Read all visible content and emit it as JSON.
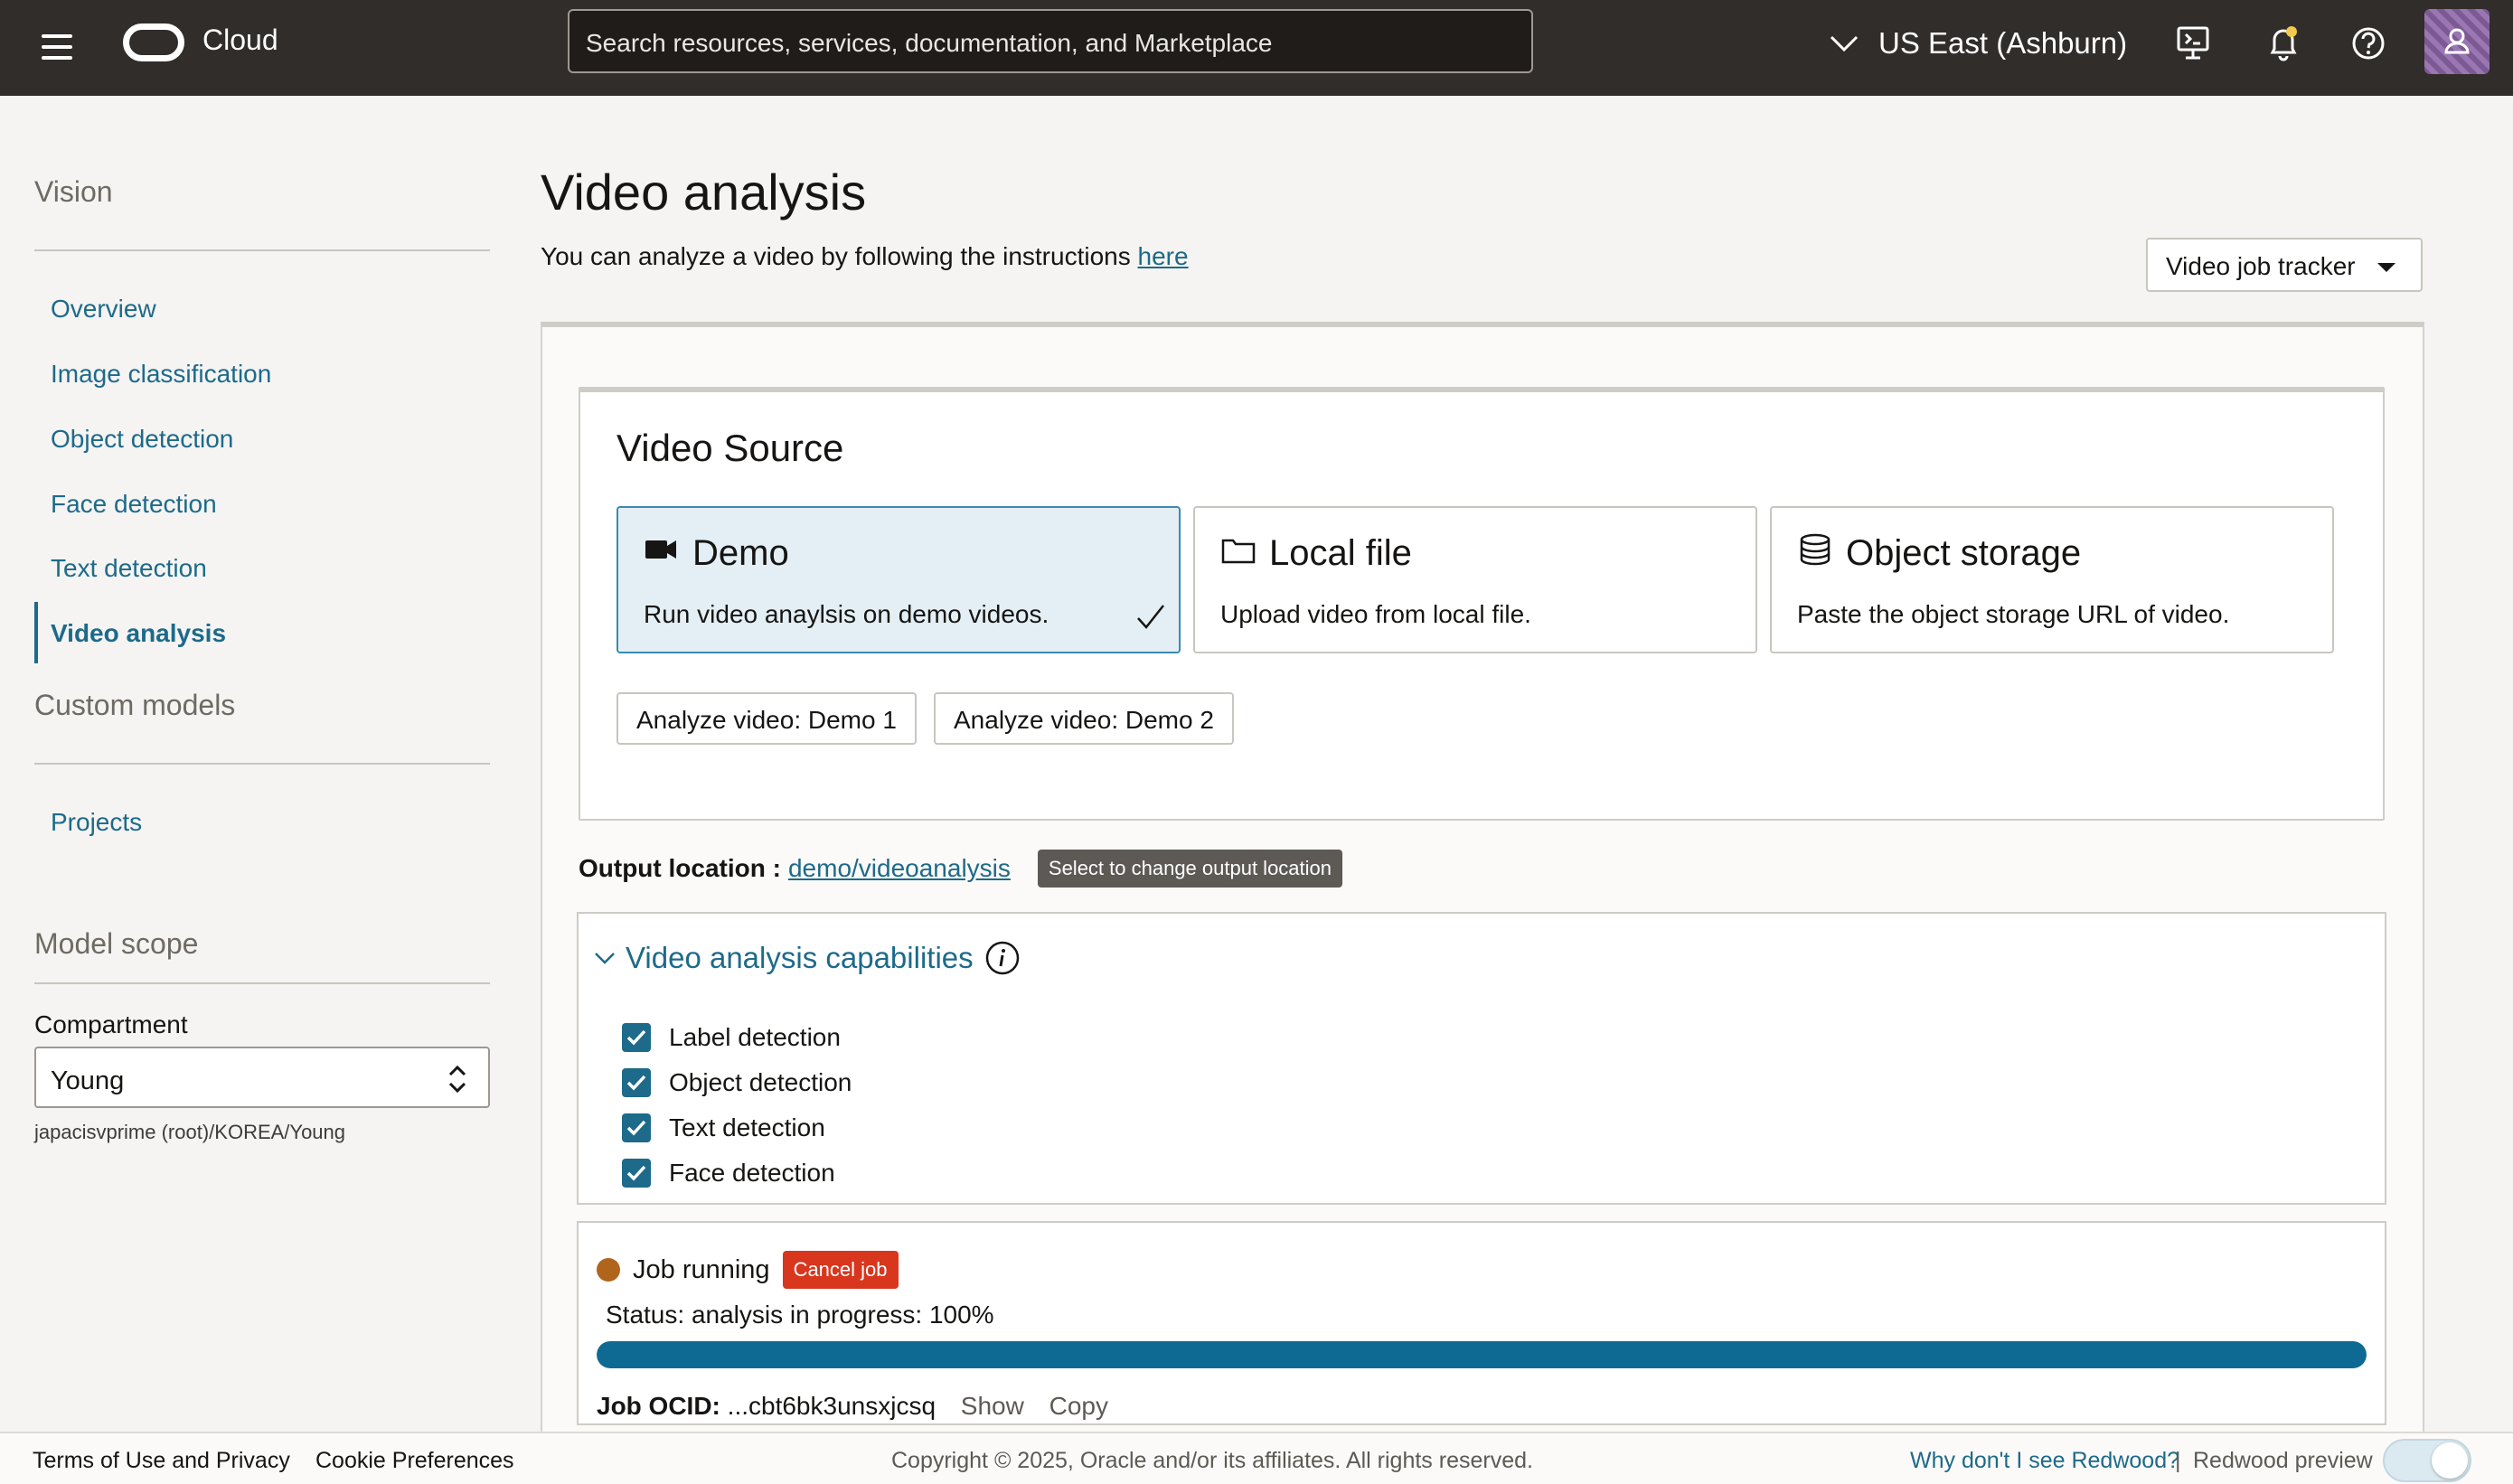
{
  "header": {
    "brand": "Cloud",
    "search_placeholder": "Search resources, services, documentation, and Marketplace",
    "region": "US East (Ashburn)"
  },
  "sidebar": {
    "section_vision": "Vision",
    "items": [
      {
        "label": "Overview"
      },
      {
        "label": "Image classification"
      },
      {
        "label": "Object detection"
      },
      {
        "label": "Face detection"
      },
      {
        "label": "Text detection"
      },
      {
        "label": "Video analysis",
        "active": true
      }
    ],
    "section_custom": "Custom models",
    "projects": "Projects",
    "section_scope": "Model scope",
    "compartment_label": "Compartment",
    "compartment_value": "Young",
    "compartment_path": "japacisvprime (root)/KOREA/Young"
  },
  "main": {
    "title": "Video analysis",
    "intro_text": "You can analyze a video by following the instructions ",
    "intro_link": "here",
    "tracker_label": "Video job tracker",
    "video_source": {
      "title": "Video Source",
      "options": [
        {
          "name": "Demo",
          "desc": "Run video anaylsis on demo videos.",
          "icon": "video-camera-icon",
          "selected": true
        },
        {
          "name": "Local file",
          "desc": "Upload video from local file.",
          "icon": "folder-icon",
          "selected": false
        },
        {
          "name": "Object storage",
          "desc": "Paste the object storage URL of video.",
          "icon": "database-icon",
          "selected": false
        }
      ],
      "buttons": [
        "Analyze video: Demo 1",
        "Analyze video: Demo 2"
      ]
    },
    "output": {
      "label": "Output location :",
      "link": "demo/videoanalysis",
      "tooltip": "Select to change output location"
    },
    "capabilities": {
      "title": "Video analysis capabilities",
      "items": [
        {
          "label": "Label detection",
          "checked": true
        },
        {
          "label": "Object detection",
          "checked": true
        },
        {
          "label": "Text detection",
          "checked": true
        },
        {
          "label": "Face detection",
          "checked": true
        }
      ]
    },
    "job": {
      "status_label": "Job running",
      "cancel_label": "Cancel job",
      "status_text": "Status: analysis in progress: 100%",
      "progress": 1.0,
      "ocid_label": "Job OCID:",
      "ocid_value": "...cbt6bk3unsxjcsq",
      "show": "Show",
      "copy": "Copy"
    }
  },
  "footer": {
    "terms": "Terms of Use and Privacy",
    "cookies": "Cookie Preferences",
    "copyright": "Copyright © 2025, Oracle and/or its affiliates. All rights reserved.",
    "redwood_link": "Why don't I see Redwood?",
    "separator": "|",
    "redwood_preview": "Redwood preview"
  },
  "colors": {
    "header_bg": "#312d2a",
    "accent": "#1d6a8a",
    "progress": "#0e6a93",
    "cancel": "#d8361d",
    "status_dot": "#b1641b"
  }
}
